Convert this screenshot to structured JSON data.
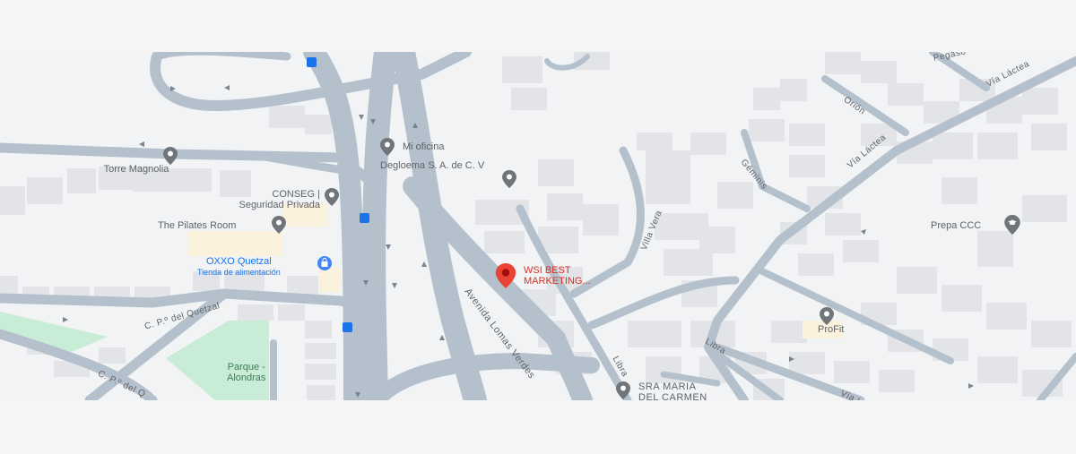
{
  "colors": {
    "page_background": "#f5f5f5",
    "map_background": "#f1f3f4",
    "road": "#b4c0cc",
    "building": "#e2e4e7",
    "park": "#c8ecd5",
    "commercial": "#fbf2dd",
    "selected_pin": "#ea4335",
    "poi_pin": "#70757a",
    "business_text": "#1a73e8",
    "selected_text": "#d93025"
  },
  "map": {
    "selected_place": {
      "name": "WSI BEST MARKETING...",
      "icon": "red-location-pin-icon"
    },
    "places": [
      {
        "id": "torre-magnolia",
        "name": "Torre Magnolia",
        "icon": "gray-pin-icon"
      },
      {
        "id": "mi-oficina",
        "name": "Mi oficina",
        "icon": "gray-pin-icon"
      },
      {
        "id": "degloema",
        "name": "Degloema S. A. de C. V",
        "icon": "gray-pin-icon"
      },
      {
        "id": "conseg",
        "name_line1": "CONSEG |",
        "name_line2": "Seguridad Privada",
        "icon": "gray-pin-icon"
      },
      {
        "id": "pilates",
        "name": "The Pilates Room",
        "icon": "gray-pin-icon"
      },
      {
        "id": "oxxo",
        "name": "OXXO Quetzal",
        "subtitle": "Tienda de alimentación",
        "icon": "shopping-bag-icon"
      },
      {
        "id": "prepa",
        "name": "Prepa CCC",
        "icon": "graduation-cap-icon"
      },
      {
        "id": "profit",
        "name": "ProFit",
        "icon": "gray-pin-icon"
      },
      {
        "id": "sra-maria",
        "name_line1": "SRA MARIA",
        "name_line2": "DEL CARMEN",
        "icon": "gray-pin-icon"
      },
      {
        "id": "parque",
        "name_line1": "Parque -",
        "name_line2": "Alondras",
        "icon": "none"
      }
    ],
    "streets": [
      {
        "id": "lomas-verdes",
        "name": "Avenida Lomas Verdes"
      },
      {
        "id": "quetzal-1",
        "name": "C. P.º del Quetzal"
      },
      {
        "id": "quetzal-2",
        "name": "C. P.º del Q"
      },
      {
        "id": "villa-vera",
        "name": "Villa Vera"
      },
      {
        "id": "via-lactea-1",
        "name": "Vía Láctea"
      },
      {
        "id": "via-lactea-2",
        "name": "Vía Láctea"
      },
      {
        "id": "via-lactea-3",
        "name": "Vía L"
      },
      {
        "id": "libra-1",
        "name": "Libra"
      },
      {
        "id": "libra-2",
        "name": "Libra"
      },
      {
        "id": "orion",
        "name": "Orión"
      },
      {
        "id": "geminis",
        "name": "Géminis"
      },
      {
        "id": "pegaso",
        "name": "Pegaso"
      }
    ]
  }
}
